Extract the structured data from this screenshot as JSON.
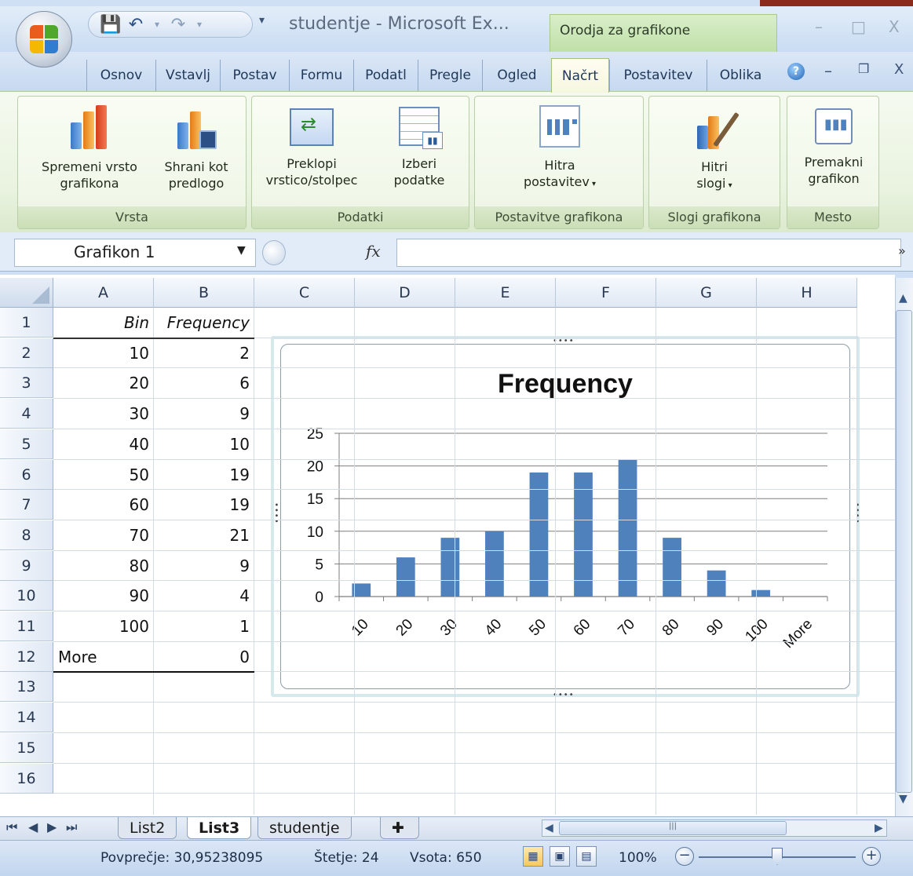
{
  "window": {
    "title": "studentje - Microsoft Ex...",
    "context_tab_group": "Orodja za grafikone"
  },
  "tabs": [
    "Osnov",
    "Vstavlj",
    "Postav",
    "Formu",
    "Podatl",
    "Pregle",
    "Ogled",
    "Načrt",
    "Postavitev",
    "Oblika"
  ],
  "active_tab": "Načrt",
  "ribbon": {
    "groups": [
      {
        "label": "Vrsta",
        "buttons": [
          {
            "line1": "Spremeni vrsto",
            "line2": "grafikona"
          },
          {
            "line1": "Shrani kot",
            "line2": "predlogo"
          }
        ]
      },
      {
        "label": "Podatki",
        "buttons": [
          {
            "line1": "Preklopi",
            "line2": "vrstico/stolpec"
          },
          {
            "line1": "Izberi",
            "line2": "podatke"
          }
        ]
      },
      {
        "label": "Postavitve grafikona",
        "buttons": [
          {
            "line1": "Hitra",
            "line2": "postavitev"
          }
        ]
      },
      {
        "label": "Slogi grafikona",
        "buttons": [
          {
            "line1": "Hitri",
            "line2": "slogi"
          }
        ]
      },
      {
        "label": "Mesto",
        "buttons": [
          {
            "line1": "Premakni",
            "line2": "grafikon"
          }
        ]
      }
    ]
  },
  "formula_bar": {
    "name_box": "Grafikon 1",
    "fx_label": "fx",
    "value": ""
  },
  "sheet": {
    "columns": [
      "A",
      "B",
      "C",
      "D",
      "E",
      "F",
      "G",
      "H"
    ],
    "rows": [
      "1",
      "2",
      "3",
      "4",
      "5",
      "6",
      "7",
      "8",
      "9",
      "10",
      "11",
      "12",
      "13",
      "14",
      "15",
      "16"
    ],
    "header_row": [
      "Bin",
      "Frequency"
    ],
    "data": [
      [
        "10",
        "2"
      ],
      [
        "20",
        "6"
      ],
      [
        "30",
        "9"
      ],
      [
        "40",
        "10"
      ],
      [
        "50",
        "19"
      ],
      [
        "60",
        "19"
      ],
      [
        "70",
        "21"
      ],
      [
        "80",
        "9"
      ],
      [
        "90",
        "4"
      ],
      [
        "100",
        "1"
      ],
      [
        "More",
        "0"
      ]
    ]
  },
  "chart_data": {
    "type": "bar",
    "title": "Frequency",
    "categories": [
      "10",
      "20",
      "30",
      "40",
      "50",
      "60",
      "70",
      "80",
      "90",
      "100",
      "More"
    ],
    "values": [
      2,
      6,
      9,
      10,
      19,
      19,
      21,
      9,
      4,
      1,
      0
    ],
    "ylim": [
      0,
      25
    ],
    "yticks": [
      0,
      5,
      10,
      15,
      20,
      25
    ],
    "grid": true,
    "bar_color": "#4f81bd"
  },
  "sheet_tabs": [
    "List2",
    "List3",
    "studentje"
  ],
  "active_sheet": "List3",
  "status_bar": {
    "average": "Povprečje: 30,95238095",
    "count": "Štetje: 24",
    "sum": "Vsota: 650",
    "zoom": "100%"
  }
}
